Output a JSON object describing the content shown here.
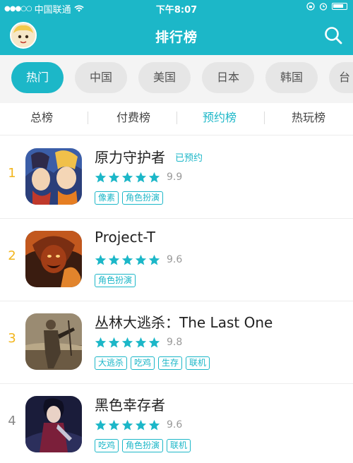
{
  "status_bar": {
    "carrier": "中国联通",
    "time": "下午8:07"
  },
  "header": {
    "title": "排行榜"
  },
  "regions": [
    {
      "label": "热门",
      "active": true
    },
    {
      "label": "中国",
      "active": false
    },
    {
      "label": "美国",
      "active": false
    },
    {
      "label": "日本",
      "active": false
    },
    {
      "label": "韩国",
      "active": false
    },
    {
      "label": "台",
      "active": false
    }
  ],
  "subtabs": [
    {
      "label": "总榜",
      "active": false
    },
    {
      "label": "付费榜",
      "active": false
    },
    {
      "label": "预约榜",
      "active": true
    },
    {
      "label": "热玩榜",
      "active": false
    }
  ],
  "apps": [
    {
      "rank": "1",
      "name": "原力守护者",
      "reserved": "已预约",
      "rating": 5,
      "score": "9.9",
      "tags": [
        "像素",
        "角色扮演"
      ],
      "rank_color": "#f2b51c"
    },
    {
      "rank": "2",
      "name": "Project-T",
      "reserved": "",
      "rating": 5,
      "score": "9.6",
      "tags": [
        "角色扮演"
      ],
      "rank_color": "#f2b51c"
    },
    {
      "rank": "3",
      "name": "丛林大逃杀：The Last One",
      "reserved": "",
      "rating": 5,
      "score": "9.8",
      "tags": [
        "大逃杀",
        "吃鸡",
        "生存",
        "联机"
      ],
      "rank_color": "#f2b51c"
    },
    {
      "rank": "4",
      "name": "黑色幸存者",
      "reserved": "",
      "rating": 5,
      "score": "9.6",
      "tags": [
        "吃鸡",
        "角色扮演",
        "联机"
      ],
      "rank_color": "#888888"
    }
  ],
  "colors": {
    "accent": "#1cb7c8",
    "rank_top": "#f2b51c"
  }
}
